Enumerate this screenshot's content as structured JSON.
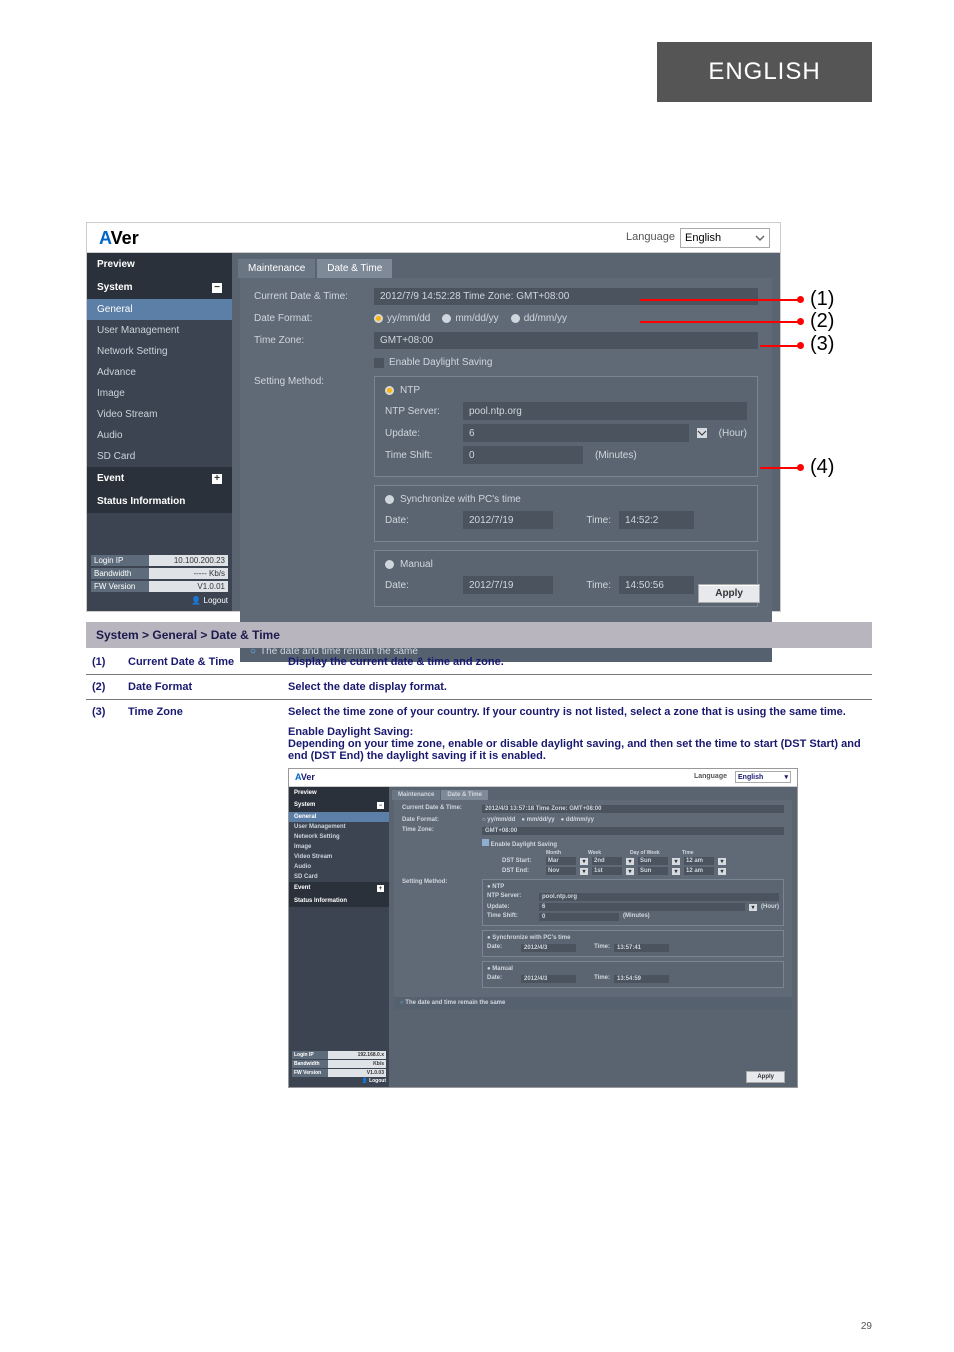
{
  "header_tab": "ENGLISH",
  "page_number": "29",
  "language": {
    "label": "Language",
    "value": "English"
  },
  "sidebar": {
    "preview": "Preview",
    "system": "System",
    "items": [
      "General",
      "User Management",
      "Network Setting",
      "Advance",
      "Image",
      "Video Stream",
      "Audio",
      "SD Card"
    ],
    "event": "Event",
    "status_info": "Status Information",
    "login_ip_k": "Login IP",
    "login_ip_v": "10.100.200.23",
    "bandwidth_k": "Bandwidth",
    "bandwidth_v": "----- Kb/s",
    "fw_k": "FW Version",
    "fw_v": "V1.0.01",
    "logout": "Logout"
  },
  "tabs": {
    "t1": "Maintenance",
    "t2": "Date & Time"
  },
  "rows": {
    "curr_l": "Current Date & Time:",
    "curr_v": "2012/7/9 14:52:28 Time Zone: GMT+08:00",
    "datefmt_l": "Date Format:",
    "fmt1": "yy/mm/dd",
    "fmt2": "mm/dd/yy",
    "fmt3": "dd/mm/yy",
    "tz_l": "Time Zone:",
    "tz_v": "GMT+08:00",
    "dst_chk": "Enable Daylight Saving",
    "method_l": "Setting Method:",
    "ntp_t": "NTP",
    "ntp_server_l": "NTP Server:",
    "ntp_server_v": "pool.ntp.org",
    "update_l": "Update:",
    "update_v": "6",
    "update_unit": "(Hour)",
    "shift_l": "Time Shift:",
    "shift_v": "0",
    "shift_unit": "(Minutes)",
    "sync_t": "Synchronize with PC's time",
    "sync_date_l": "Date:",
    "sync_date_v": "2012/7/19",
    "sync_time_l": "Time:",
    "sync_time_v": "14:52:2",
    "manual_t": "Manual",
    "man_date_l": "Date:",
    "man_date_v": "2012/7/19",
    "man_time_l": "Time:",
    "man_time_v": "14:50:56",
    "remain": "The date and time remain the same",
    "apply": "Apply"
  },
  "callouts": {
    "c1": "(1)",
    "c2": "(2)",
    "c3": "(3)",
    "c4": "(4)"
  },
  "desc": {
    "title": "System > General > Date & Time",
    "r1n": "Current Date & Time",
    "r1d": "Display the current date & time and zone.",
    "r2n": "Date Format",
    "r2d": "Select the date display format.",
    "r3n": "Time Zone",
    "r3d1": "Select the time zone of your country. If your country is not listed, select a zone that is using the same time.",
    "r3d2": "Enable Daylight Saving:",
    "r3d3": "Depending on your time zone, enable or disable daylight saving, and then set the time to start (DST Start) and end (DST End) the daylight saving if it is enabled."
  },
  "thumb": {
    "logo_a": "A",
    "logo_ver": "Ver",
    "lang_label": "Language",
    "lang_value": "English",
    "sb_preview": "Preview",
    "sb_system": "System",
    "sb_items": [
      "General",
      "User Management",
      "Network Setting",
      "Image",
      "Video Stream",
      "Audio",
      "SD Card"
    ],
    "sb_event": "Event",
    "sb_status_info": "Status Information",
    "tab1": "Maintenance",
    "tab2": "Date & Time",
    "curr_l": "Current Date & Time:",
    "curr_v": "2012/4/3 13:57:18 Time Zone: GMT+08:00",
    "datefmt_l": "Date Format:",
    "fmt1": "yy/mm/dd",
    "fmt2": "mm/dd/yy",
    "fmt3": "dd/mm/yy",
    "tz_l": "Time Zone:",
    "tz_v": "GMT+08:00",
    "dst_chk": "Enable Daylight Saving",
    "dst_cols": {
      "month": "Month",
      "week": "Week",
      "dow": "Day of Week",
      "time": "Time"
    },
    "dst_start_l": "DST Start:",
    "dst_start": {
      "month": "Mar",
      "week": "2nd",
      "dow": "Sun",
      "time": "12 am"
    },
    "dst_end_l": "DST End:",
    "dst_end": {
      "month": "Nov",
      "week": "1st",
      "dow": "Sun",
      "time": "12 am"
    },
    "method_l": "Setting Method:",
    "ntp_t": "NTP",
    "ntp_server_l": "NTP Server:",
    "ntp_server_v": "pool.ntp.org",
    "update_l": "Update:",
    "update_v": "6",
    "update_unit": "(Hour)",
    "shift_l": "Time Shift:",
    "shift_v": "0",
    "shift_unit": "(Minutes)",
    "sync_t": "Synchronize with PC's time",
    "sync_date_l": "Date:",
    "sync_date_v": "2012/4/3",
    "sync_time_l": "Time:",
    "sync_time_v": "13:57:41",
    "man_t": "Manual",
    "man_date_l": "Date:",
    "man_date_v": "2012/4/3",
    "man_time_l": "Time:",
    "man_time_v": "13:54:59",
    "remain": "The date and time remain the same",
    "apply": "Apply",
    "login_ip_k": "Login IP",
    "login_ip_v": "192.168.0.x",
    "bandwidth_k": "Bandwidth",
    "bandwidth_v": "Kb/s",
    "fw_k": "FW Version",
    "fw_v": "V1.0.03",
    "logout": "Logout"
  }
}
